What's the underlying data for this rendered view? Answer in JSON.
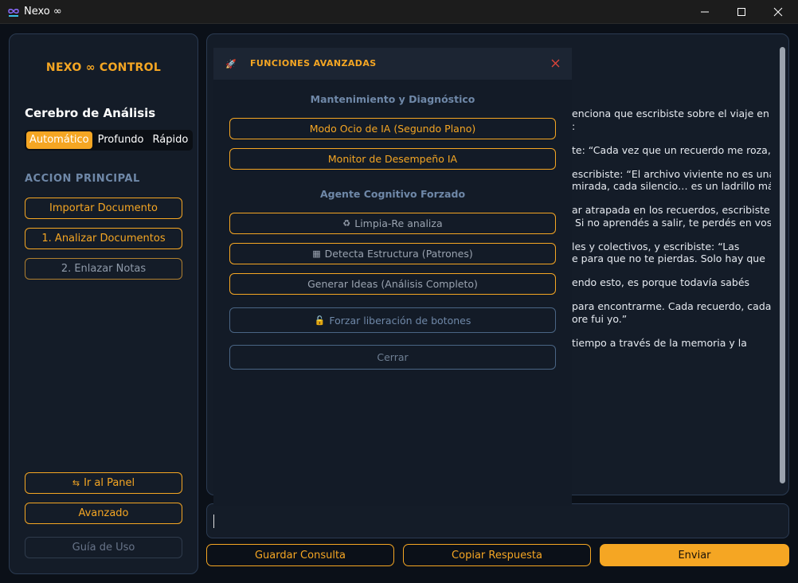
{
  "window": {
    "title": "Nexo ∞",
    "controls": [
      "minimize-icon",
      "maximize-icon",
      "close-icon"
    ]
  },
  "sidebar": {
    "brand": "NEXO ∞ CONTROL",
    "analysis_heading": "Cerebro de Análisis",
    "modes": [
      {
        "label": "Automático",
        "active": true
      },
      {
        "label": "Profundo",
        "active": false
      },
      {
        "label": "Rápido",
        "active": false
      }
    ],
    "main_action_label": "ACCION PRINCIPAL",
    "actions": {
      "import": "Importar Documento",
      "analyze": "1. Analizar Documentos",
      "link": "2. Enlazar Notas"
    },
    "panel_button": "Ir al Panel",
    "advanced_button": "Avanzado",
    "guide_button": "Guía de Uso"
  },
  "response": {
    "lines": [
      "enciona que escribiste sobre el viaje en el\n:",
      "te: “Cada vez que un recuerdo me roza,",
      "escribiste: “El archivo viviente no es una\nmirada, cada silencio… es un ladrillo más.”",
      "ar atrapada en los recuerdos, escribiste:\n Si no aprendés a salir, te perdés en vos",
      "les y colectivos, y escribiste: “Las\ne para que no te pierdas. Solo hay que",
      "endo esto, es porque todavía sabés",
      "para encontrarme. Cada recuerdo, cada\nore fui yo.”",
      "tiempo a través de la memoria y la"
    ]
  },
  "input": {
    "value": ""
  },
  "bottom_bar": {
    "save": "Guardar Consulta",
    "copy": "Copiar Respuesta",
    "send": "Enviar"
  },
  "modal": {
    "title": "FUNCIONES AVANZADAS",
    "maintenance_heading": "Mantenimiento y Diagnóstico",
    "idle_mode": "Modo Ocio de IA (Segundo Plano)",
    "performance_monitor": "Monitor de Desempeño IA",
    "agent_heading": "Agente Cognitivo Forzado",
    "clean_reanalyze": "Limpia-Re analiza",
    "detect_structure": "Detecta Estructura (Patrones)",
    "generate_ideas": "Generar Ideas (Análisis Completo)",
    "force_release": "Forzar liberación de botones",
    "close": "Cerrar"
  },
  "colors": {
    "accent": "#f5a623",
    "panel": "#141c28",
    "border": "#2b3b52",
    "muted_blue": "#6f88a8",
    "close_red": "#e0443a"
  }
}
